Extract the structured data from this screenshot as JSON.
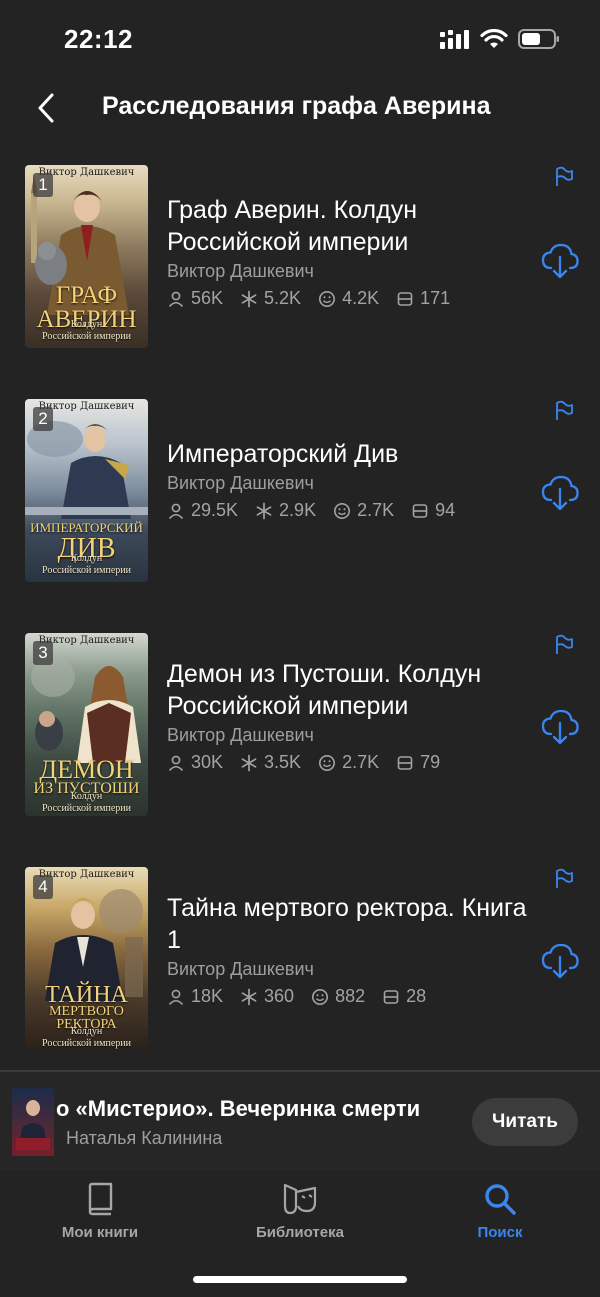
{
  "status_bar": {
    "time": "22:12"
  },
  "header": {
    "title": "Расследования графа Аверина"
  },
  "books": [
    {
      "number": "1",
      "title": "Граф Аверин. Колдун Российской империи",
      "author": "Виктор Дашкевич",
      "stats": {
        "readers": "56K",
        "rating": "5.2K",
        "likes": "4.2K",
        "comments": "171"
      },
      "cover": {
        "author": "Виктор Дашкевич",
        "title_lines": [
          "ГРАФ",
          "АВЕРИН"
        ],
        "sub": "Колдун\nРоссийской империи"
      }
    },
    {
      "number": "2",
      "title": "Императорский Див",
      "author": "Виктор Дашкевич",
      "stats": {
        "readers": "29.5K",
        "rating": "2.9K",
        "likes": "2.7K",
        "comments": "94"
      },
      "cover": {
        "author": "Виктор Дашкевич",
        "title_lines": [
          "ИМПЕРАТОРСКИЙ",
          "ДИВ"
        ],
        "sub": "Колдун\nРоссийской империи"
      }
    },
    {
      "number": "3",
      "title": "Демон из Пустоши. Колдун Российской империи",
      "author": "Виктор Дашкевич",
      "stats": {
        "readers": "30K",
        "rating": "3.5K",
        "likes": "2.7K",
        "comments": "79"
      },
      "cover": {
        "author": "Виктор Дашкевич",
        "title_lines": [
          "ДЕМОН",
          "ИЗ ПУСТОШИ"
        ],
        "sub": "Колдун\nРоссийской империи"
      }
    },
    {
      "number": "4",
      "title": "Тайна мертвого ректора. Книга 1",
      "author": "Виктор Дашкевич",
      "stats": {
        "readers": "18K",
        "rating": "360",
        "likes": "882",
        "comments": "28"
      },
      "cover": {
        "author": "Виктор Дашкевич",
        "title_lines": [
          "ТАЙНА",
          "МЕРТВОГО",
          "РЕКТОРА"
        ],
        "sub": "Колдун\nРоссийской империи"
      }
    }
  ],
  "mini_player": {
    "title": "о «Мистерио». Вечеринка смерти",
    "author": "Наталья Калинина",
    "read_label": "Читать"
  },
  "tabs": [
    {
      "label": "Мои книги",
      "icon": "book-icon"
    },
    {
      "label": "Библиотека",
      "icon": "library-mask-icon"
    },
    {
      "label": "Поиск",
      "icon": "search-icon"
    }
  ],
  "colors": {
    "background": "#232323",
    "accent": "#3a86f0",
    "muted_text": "#9e9e9e"
  }
}
